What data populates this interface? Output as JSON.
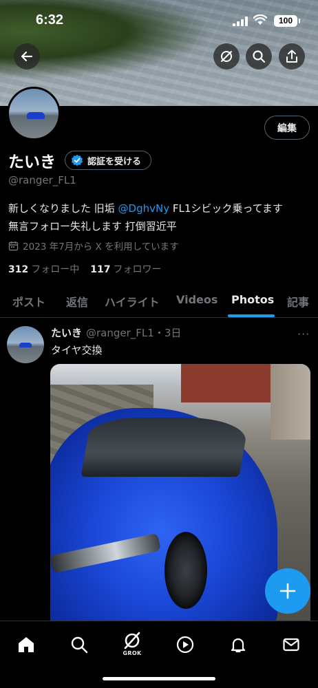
{
  "status_bar": {
    "time": "6:32",
    "battery": "100"
  },
  "profile": {
    "edit_label": "編集",
    "name": "たいき",
    "verify_label": "認証を受ける",
    "handle": "@ranger_FL1",
    "bio_line1_pre": "新しくなりました 旧垢 ",
    "bio_mention": "@DghvNy",
    "bio_line1_post": " FL1シビック乗ってます",
    "bio_line2": "無言フォロー失礼します 打倒習近平",
    "joined": "2023 年7月から X を利用しています",
    "following_count": "312",
    "following_label": "フォロー中",
    "followers_count": "117",
    "followers_label": "フォロワー"
  },
  "tabs": [
    "ポスト",
    "返信",
    "ハイライト",
    "Videos",
    "Photos",
    "記事"
  ],
  "active_tab": "Photos",
  "post": {
    "name": "たいき",
    "handle_time": "@ranger_FL1・3日",
    "text": "タイヤ交換",
    "more": "···"
  },
  "bottom_nav": {
    "grok_label": "GROK"
  },
  "icons": [
    "back-arrow-icon",
    "grok-icon",
    "search-icon",
    "share-icon",
    "verified-badge-icon",
    "calendar-icon",
    "more-icon",
    "plus-icon",
    "home-icon",
    "play-icon",
    "bell-icon",
    "mail-icon"
  ],
  "colors": {
    "accent": "#1d9bf0",
    "background": "#000000",
    "muted": "#71767b"
  }
}
